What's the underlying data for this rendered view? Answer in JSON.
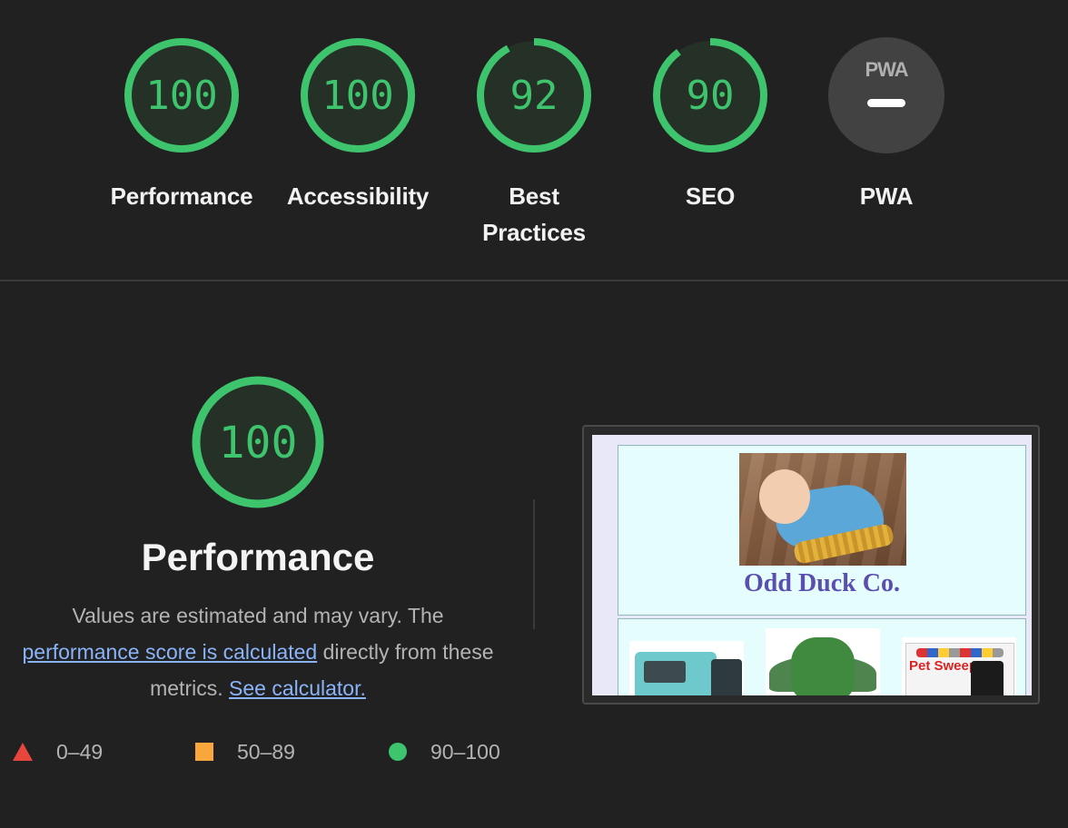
{
  "gauges": [
    {
      "score": "100",
      "label": "Performance",
      "fraction": 1.0
    },
    {
      "score": "100",
      "label": "Accessibility",
      "fraction": 1.0
    },
    {
      "score": "92",
      "label_line1": "Best",
      "label_line2": "Practices",
      "fraction": 0.92
    },
    {
      "score": "90",
      "label": "SEO",
      "fraction": 0.9
    },
    {
      "badge": "PWA",
      "label": "PWA"
    }
  ],
  "performance": {
    "score": "100",
    "title": "Performance",
    "desc_prefix": "Values are estimated and may vary. The",
    "score_link": "performance score is calculated",
    "desc_middle": "directly from these metrics.",
    "calc_link": "See calculator."
  },
  "legend": [
    {
      "range": "0–49",
      "color": "#e8453c",
      "shape": "triangle"
    },
    {
      "range": "50–89",
      "color": "#f8a73d",
      "shape": "square"
    },
    {
      "range": "90–100",
      "color": "#3ec46d",
      "shape": "circle"
    }
  ],
  "screenshot": {
    "brand": "Odd Duck Co.",
    "product3_text": "Pet Sweep"
  },
  "colors": {
    "pass": "#3ec46d",
    "gauge_bg": "#253026",
    "page_bg": "#212121",
    "link": "#8ab4f8"
  }
}
